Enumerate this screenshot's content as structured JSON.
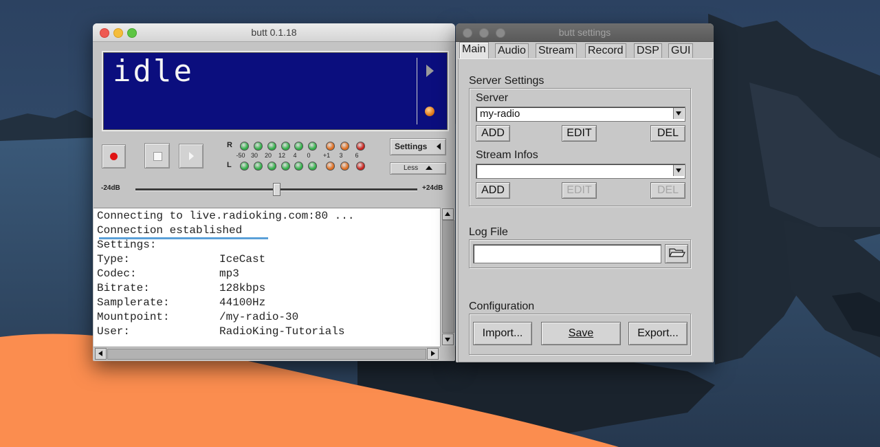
{
  "main_window": {
    "title": "butt 0.1.18",
    "lcd_status": "idle",
    "vu": {
      "r_label": "R",
      "l_label": "L",
      "scale": [
        "-50",
        "30",
        "20",
        "12",
        "4",
        "0",
        "+1",
        "3",
        "6"
      ],
      "colors": {
        "green": "#33b04a",
        "orange": "#e06f21",
        "red": "#c9231d"
      }
    },
    "settings_button": "Settings",
    "less_button": "Less",
    "gain": {
      "min_label": "-24dB",
      "max_label": "+24dB"
    },
    "log": {
      "line1": "Connecting to live.radioking.com:80 ...",
      "line2": "Connection established",
      "line3": "Settings:",
      "rows": [
        {
          "key": "Type:",
          "value": "IceCast"
        },
        {
          "key": "Codec:",
          "value": "mp3"
        },
        {
          "key": "Bitrate:",
          "value": "128kbps"
        },
        {
          "key": "Samplerate:",
          "value": "44100Hz"
        },
        {
          "key": "Mountpoint:",
          "value": "/my-radio-30"
        },
        {
          "key": "User:",
          "value": "RadioKing-Tutorials"
        }
      ]
    }
  },
  "settings_window": {
    "title": "butt settings",
    "tabs": [
      "Main",
      "Audio",
      "Stream",
      "Record",
      "DSP",
      "GUI"
    ],
    "active_tab": "Main",
    "server_settings_label": "Server Settings",
    "server_label": "Server",
    "server_value": "my-radio",
    "server_add": "ADD",
    "server_edit": "EDIT",
    "server_del": "DEL",
    "stream_infos_label": "Stream Infos",
    "stream_add": "ADD",
    "stream_edit": "EDIT",
    "stream_del": "DEL",
    "log_file_label": "Log File",
    "configuration_label": "Configuration",
    "import_button": "Import...",
    "save_button": "Save",
    "export_button": "Export..."
  },
  "theme": {
    "accent_orange": "#ff8c4b",
    "lcd_background": "#0b0e7e",
    "log_underline": "#5aa0d8"
  }
}
